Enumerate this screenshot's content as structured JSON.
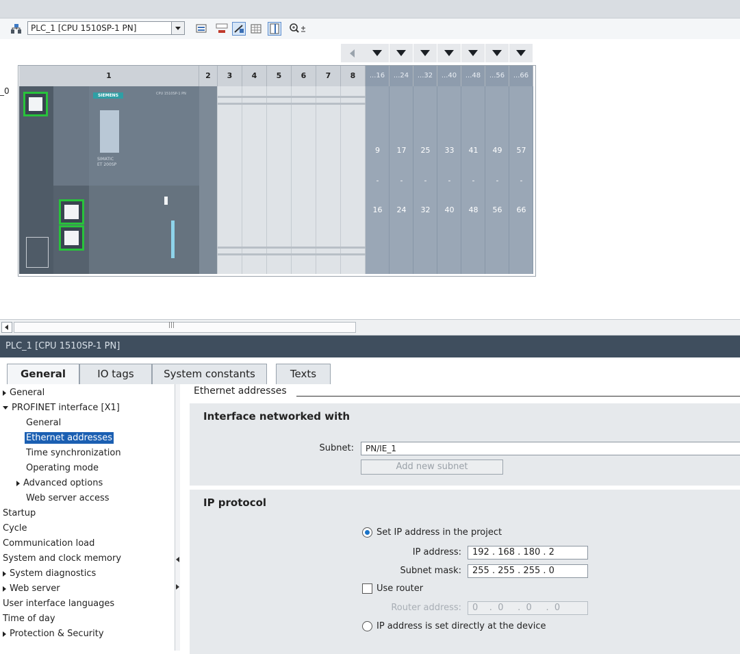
{
  "toolbar": {
    "device_select": "PLC_1 [CPU 1510SP-1 PN]",
    "icons": [
      "network-icon",
      "device-dropdown",
      "io-overview-icon",
      "name-icon",
      "wire-icon",
      "grid-icon",
      "table-icon",
      "zoom-icon"
    ]
  },
  "rack": {
    "row_label": "_0",
    "slots": [
      "1",
      "2",
      "3",
      "4",
      "5",
      "6",
      "7",
      "8"
    ],
    "ext_heads": [
      "...16",
      "...24",
      "...32",
      "...40",
      "...48",
      "...56",
      "...66"
    ],
    "ext_from": [
      "9",
      "17",
      "25",
      "33",
      "41",
      "49",
      "57"
    ],
    "ext_dash": "-",
    "ext_to": [
      "16",
      "24",
      "32",
      "40",
      "48",
      "56",
      "66"
    ],
    "cpu_brand": "SIEMENS",
    "cpu_model_line1": "SIMATIC",
    "cpu_model_line2": "ET 200SP",
    "cpu_small": "CPU 1510SP-1 PN"
  },
  "scrollbar": {
    "grip": "|||"
  },
  "properties": {
    "title": "PLC_1 [CPU 1510SP-1 PN]",
    "tabs": [
      "General",
      "IO tags",
      "System constants",
      "Texts"
    ],
    "nav": [
      {
        "label": "General",
        "indent": 0,
        "tri": "right"
      },
      {
        "label": "PROFINET interface [X1]",
        "indent": 0,
        "tri": "down"
      },
      {
        "label": "General",
        "indent": 1,
        "tri": ""
      },
      {
        "label": "Ethernet addresses",
        "indent": 1,
        "tri": "",
        "selected": true
      },
      {
        "label": "Time synchronization",
        "indent": 1,
        "tri": ""
      },
      {
        "label": "Operating mode",
        "indent": 1,
        "tri": ""
      },
      {
        "label": "Advanced options",
        "indent": 1,
        "tri": "right"
      },
      {
        "label": "Web server access",
        "indent": 1,
        "tri": ""
      },
      {
        "label": "Startup",
        "indent": 0,
        "tri": ""
      },
      {
        "label": "Cycle",
        "indent": 0,
        "tri": ""
      },
      {
        "label": "Communication load",
        "indent": 0,
        "tri": ""
      },
      {
        "label": "System and clock memory",
        "indent": 0,
        "tri": ""
      },
      {
        "label": "System diagnostics",
        "indent": 0,
        "tri": "right"
      },
      {
        "label": "Web server",
        "indent": 0,
        "tri": "right"
      },
      {
        "label": "User interface languages",
        "indent": 0,
        "tri": ""
      },
      {
        "label": "Time of day",
        "indent": 0,
        "tri": ""
      },
      {
        "label": "Protection & Security",
        "indent": 0,
        "tri": "right"
      }
    ],
    "section_title": "Ethernet addresses",
    "interface": {
      "heading": "Interface networked with",
      "subnet_label": "Subnet:",
      "subnet_value": "PN/IE_1",
      "add_subnet": "Add new subnet"
    },
    "ip": {
      "heading": "IP protocol",
      "set_in_project": "Set IP address in the project",
      "ip_label": "IP address:",
      "ip_value": "192 . 168 . 180 . 2",
      "mask_label": "Subnet mask:",
      "mask_value": "255 . 255 . 255 . 0",
      "use_router": "Use router",
      "router_label": "Router address:",
      "router_value": "0    .  0     .  0     .  0",
      "set_at_device": "IP address is set directly at the device"
    }
  }
}
